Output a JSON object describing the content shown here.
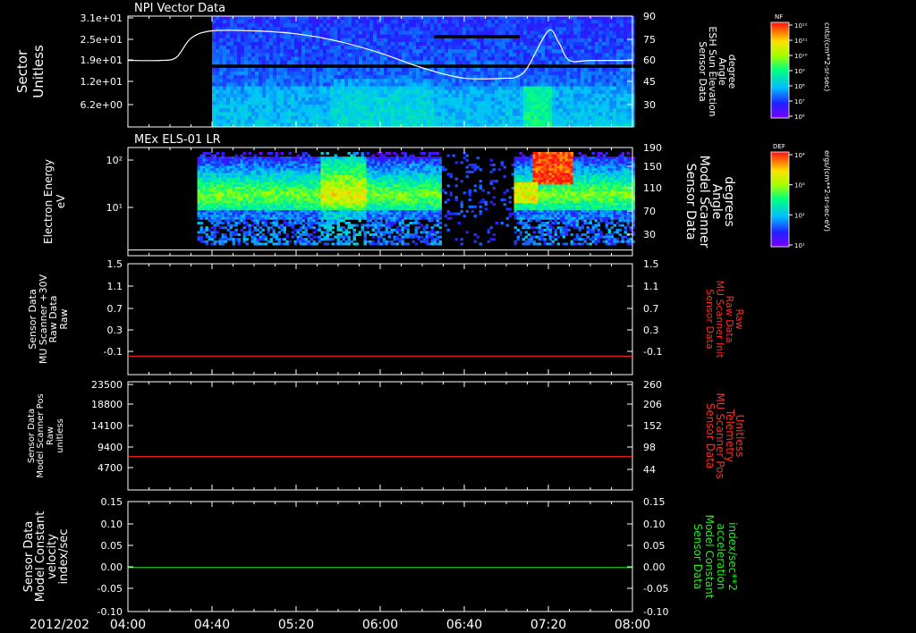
{
  "date_label": "2012/202",
  "time_ticks": [
    "04:00",
    "04:40",
    "05:20",
    "06:00",
    "06:40",
    "07:20",
    "08:00"
  ],
  "colors": {
    "background": "#000000",
    "axes": "#ffffff",
    "red_line": "#ff2020",
    "green_line": "#20e020"
  },
  "panels": [
    {
      "title": "NPI Vector Data",
      "left_label": [
        "Sector",
        "Unitless"
      ],
      "left_ticks": [
        "3.1e+01",
        "2.5e+01",
        "1.9e+01",
        "1.2e+01",
        "6.2e+00"
      ],
      "right_label": [
        "Sensor Data",
        "ESH Sun Elevation",
        "Angle",
        "degree"
      ],
      "right_ticks": [
        "90",
        "75",
        "60",
        "45",
        "30"
      ],
      "colorbar": {
        "name": "NF",
        "units": "cnts/(cm**2-sr-sec)",
        "ticks": [
          "10¹²",
          "10¹¹",
          "10¹⁰",
          "10⁹",
          "10⁸",
          "10⁷",
          "10⁶"
        ]
      }
    },
    {
      "title": "MEx ELS-01 LR",
      "left_label": [
        "Electron Energy",
        "eV"
      ],
      "left_ticks": [
        "10²",
        "10¹"
      ],
      "right_label": [
        "Sensor Data",
        "Model Scanner",
        "Angle",
        "degrees"
      ],
      "right_ticks": [
        "190",
        "150",
        "110",
        "70",
        "30"
      ],
      "colorbar": {
        "name": "DEF",
        "units": "ergs/(cm**2-sr-sec-eV)",
        "ticks": [
          "10⁴",
          "10³",
          "10²",
          "10¹"
        ]
      }
    },
    {
      "left_label": [
        "Sensor Data",
        "MU Scanner +30V",
        "Raw Data",
        "Raw"
      ],
      "left_ticks": [
        "1.5",
        "1.1",
        "0.7",
        "0.3",
        "-0.1"
      ],
      "right_label": [
        "Sensor Data",
        "MU Scanner Init",
        "Raw Data",
        "Raw"
      ],
      "right_ticks": [
        "1.5",
        "1.1",
        "0.7",
        "0.3",
        "-0.1"
      ]
    },
    {
      "left_label": [
        "Sensor Data",
        "Model Scanner Pos",
        "Raw",
        "unitless"
      ],
      "left_ticks": [
        "23500",
        "18800",
        "14100",
        "9400",
        "4700"
      ],
      "right_label": [
        "Sensor Data",
        "MU Scanner Pos",
        "Telemetry",
        "Unitless"
      ],
      "right_ticks": [
        "260",
        "206",
        "152",
        "98",
        "44"
      ]
    },
    {
      "left_label": [
        "Sensor Data",
        "Model Constant",
        "velocity",
        "index/sec"
      ],
      "left_ticks": [
        "0.15",
        "0.10",
        "0.05",
        "0.00",
        "-0.05",
        "-0.10"
      ],
      "right_label": [
        "Sensor Data",
        "Model Constant",
        "acceleration",
        "index/sec**2"
      ],
      "right_ticks": [
        "0.15",
        "0.10",
        "0.05",
        "0.00",
        "-0.05",
        "-0.10"
      ]
    }
  ],
  "chart_data": [
    {
      "type": "heatmap",
      "title": "NPI Vector Data",
      "xlabel": "",
      "ylabel": "Sector Unitless",
      "x_range": [
        "04:00",
        "08:00"
      ],
      "ylim": [
        0,
        31
      ],
      "data_start": "04:40",
      "overlay_series": {
        "name": "Sensor Data ESH Sun Elevation Angle",
        "axis": "right",
        "ylim": [
          15,
          90
        ],
        "x": [
          "04:00",
          "04:15",
          "04:23",
          "04:30",
          "04:40",
          "05:00",
          "05:20",
          "05:40",
          "06:00",
          "06:20",
          "06:40",
          "07:00",
          "07:05",
          "07:10",
          "07:20",
          "07:25",
          "07:30",
          "07:40",
          "08:00"
        ],
        "y": [
          60,
          60,
          62,
          75,
          80,
          80,
          78,
          73,
          65,
          55,
          48,
          48,
          49,
          55,
          80,
          72,
          60,
          60,
          60
        ]
      }
    },
    {
      "type": "heatmap",
      "title": "MEx ELS-01 LR",
      "xlabel": "",
      "ylabel": "Electron Energy eV",
      "x_range": [
        "04:00",
        "08:00"
      ],
      "y_scale": "log",
      "data_start": "04:33",
      "overlay_series": {
        "name": "Sensor Data Model Scanner Angle",
        "axis": "right",
        "ylim": [
          0,
          190
        ],
        "x": [
          "04:00",
          "08:00"
        ],
        "y": [
          10,
          10
        ]
      }
    },
    {
      "type": "line",
      "title": "",
      "x": [
        "04:00",
        "08:00"
      ],
      "series": [
        {
          "name": "Sensor Data MU Scanner Init Raw Data Raw",
          "values": [
            0.0,
            0.0
          ]
        }
      ],
      "ylim": [
        -0.3,
        1.5
      ]
    },
    {
      "type": "line",
      "title": "",
      "x": [
        "04:00",
        "08:00"
      ],
      "series": [
        {
          "name": "Sensor Data MU Scanner Pos Telemetry Unitless",
          "values": [
            80,
            80
          ]
        }
      ],
      "ylim": [
        0,
        260
      ]
    },
    {
      "type": "line",
      "title": "",
      "x": [
        "04:00",
        "08:00"
      ],
      "series": [
        {
          "name": "Sensor Data Model Constant acceleration index/sec**2",
          "values": [
            0.0,
            0.0
          ]
        }
      ],
      "ylim": [
        -0.1,
        0.15
      ]
    }
  ]
}
